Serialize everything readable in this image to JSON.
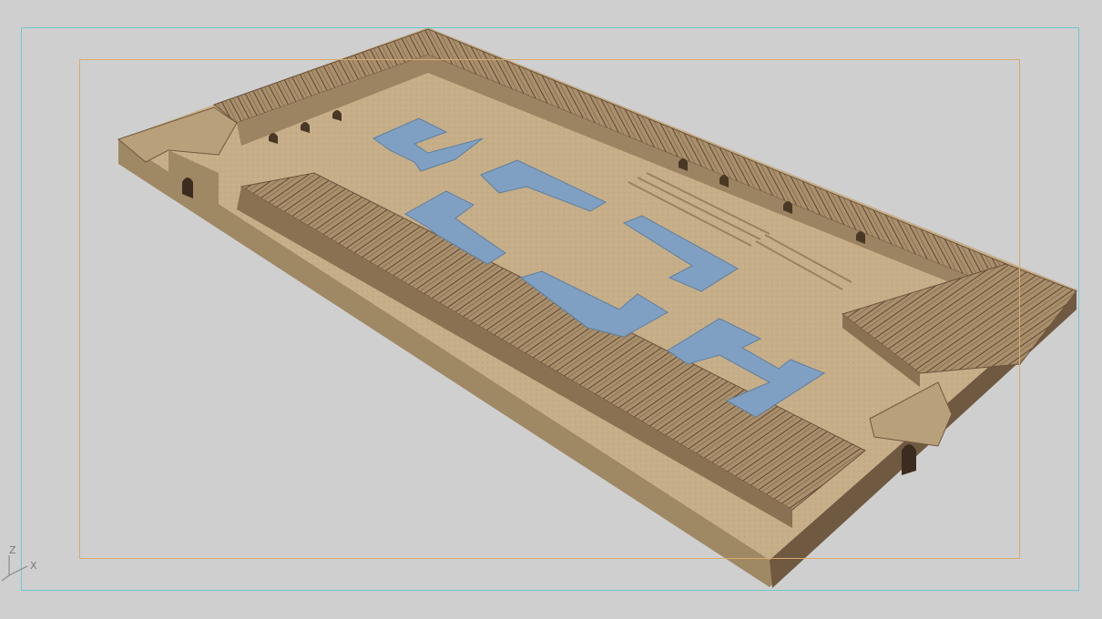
{
  "viewport": {
    "view_type": "3D perspective viewport",
    "background_color": "#cfcfcf",
    "safe_frame_outer_color": "#6fc6cf",
    "safe_frame_inner_color": "#d7a96e"
  },
  "model": {
    "ground_color": "#c5ad86",
    "wall_color": "#b39b75",
    "wall_shadow_color": "#5a4632",
    "truss_color": "#7a6248",
    "pool_color": "#7fa0c2"
  },
  "axis_gizmo": {
    "z_label": "Z",
    "x_label": "X",
    "icon": "axis-tripod-icon"
  }
}
